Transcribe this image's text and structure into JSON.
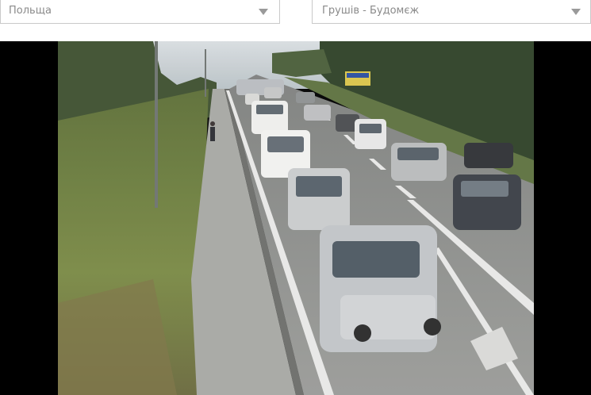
{
  "selectors": {
    "country": {
      "value": "Польща"
    },
    "crossing": {
      "value": "Грушів - Будомєж"
    }
  },
  "video": {
    "colors": {
      "frame_background": "#000000",
      "sky": "#c9d0d4",
      "grass": "#7c8d4a",
      "asphalt": "#8f908e",
      "road_marking": "#e8e8e6"
    }
  }
}
